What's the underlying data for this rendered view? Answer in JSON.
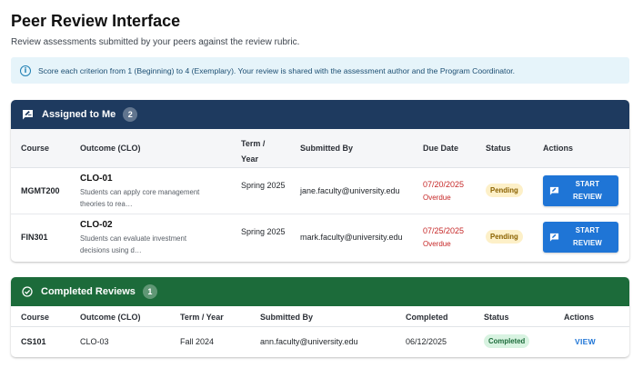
{
  "page": {
    "title": "Peer Review Interface",
    "subtitle": "Review assessments submitted by your peers against the review rubric."
  },
  "alert": {
    "icon": "info-icon",
    "text": "Score each criterion from 1 (Beginning) to 4 (Exemplary). Your review is shared with the assessment author and the Program Coordinator."
  },
  "assigned": {
    "title": "Assigned to Me",
    "count": "2",
    "header_color": "#1e3a5f",
    "columns": {
      "course": "Course",
      "outcome": "Outcome (CLO)",
      "term_line1": "Term /",
      "term_line2": "Year",
      "submitted_by": "Submitted By",
      "due_date": "Due Date",
      "status": "Status",
      "actions": "Actions"
    },
    "rows": [
      {
        "course": "MGMT200",
        "clo_id": "CLO-01",
        "clo_desc": "Students can apply core management theories to rea…",
        "term": "Spring 2025",
        "submitted_by": "jane.faculty@university.edu",
        "due_date": "07/20/2025",
        "due_note": "Overdue",
        "status": "Pending",
        "action_line1": "START",
        "action_line2": "REVIEW"
      },
      {
        "course": "FIN301",
        "clo_id": "CLO-02",
        "clo_desc": "Students can evaluate investment decisions using d…",
        "term": "Spring 2025",
        "submitted_by": "mark.faculty@university.edu",
        "due_date": "07/25/2025",
        "due_note": "Overdue",
        "status": "Pending",
        "action_line1": "START",
        "action_line2": "REVIEW"
      }
    ]
  },
  "completed": {
    "title": "Completed Reviews",
    "count": "1",
    "header_color": "#1c6b3a",
    "columns": {
      "course": "Course",
      "outcome": "Outcome (CLO)",
      "term": "Term / Year",
      "submitted_by": "Submitted By",
      "completed": "Completed",
      "status": "Status",
      "actions": "Actions"
    },
    "rows": [
      {
        "course": "CS101",
        "clo_id": "CLO-03",
        "term": "Fall 2024",
        "submitted_by": "ann.faculty@university.edu",
        "completed": "06/12/2025",
        "status": "Completed",
        "action": "VIEW"
      }
    ]
  },
  "colors": {
    "primary_button": "#1f75d6",
    "overdue": "#c62828",
    "pending_bg": "#fdf0c8",
    "completed_bg": "#d8f3e1"
  }
}
